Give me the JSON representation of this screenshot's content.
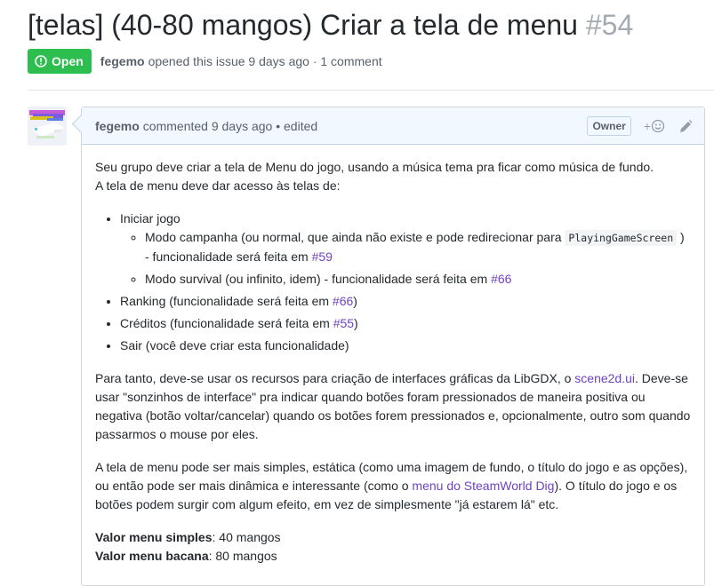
{
  "issue": {
    "title": "[telas] (40-80 mangos) Criar a tela de menu",
    "number": "#54",
    "state": "Open",
    "author": "fegemo",
    "meta": "opened this issue 9 days ago · 1 comment"
  },
  "comment": {
    "author": "fegemo",
    "meta": "commented 9 days ago • edited",
    "owner_label": "Owner",
    "paragraph1_line1": "Seu grupo deve criar a tela de Menu do jogo, usando a música tema pra ficar como música de fundo.",
    "paragraph1_line2": "A tela de menu deve dar acesso às telas de:",
    "list": {
      "item1": "Iniciar jogo",
      "sub1_text": "Modo campanha (ou normal, que ainda não existe e pode redirecionar para ",
      "sub1_code": "PlayingGameScreen",
      "sub1_text2": " ) - funcionalidade será feita em ",
      "sub1_link": "#59",
      "sub2_text": "Modo survival (ou infinito, idem) - funcionalidade será feita em ",
      "sub2_link": "#66",
      "item2_text": "Ranking (funcionalidade será feita em ",
      "item2_link": "#66",
      "item2_end": ")",
      "item3_text": "Créditos (funcionalidade será feita em ",
      "item3_link": "#55",
      "item3_end": ")",
      "item4": "Sair (você deve criar esta funcionalidade)"
    },
    "paragraph2_a": "Para tanto, deve-se usar os recursos para criação de interfaces gráficas da LibGDX, o ",
    "paragraph2_link": "scene2d.ui",
    "paragraph2_b": ". Deve-se usar \"sonzinhos de interface\" pra indicar quando botões foram pressionados de maneira positiva ou negativa (botão voltar/cancelar) quando os botões forem pressionados e, opcionalmente, outro som quando passarmos o mouse por eles.",
    "paragraph3_a": "A tela de menu pode ser mais simples, estática (como uma imagem de fundo, o título do jogo e as opções), ou então pode ser mais dinâmica e interessante (como o ",
    "paragraph3_link": "menu do SteamWorld Dig",
    "paragraph3_b": "). O título do jogo e os botões podem surgir com algum efeito, em vez de simplesmente \"já estarem lá\" etc.",
    "value_simple_label": "Valor menu simples",
    "value_simple": ": 40 mangos",
    "value_fancy_label": "Valor menu bacana",
    "value_fancy": ": 80 mangos"
  },
  "colors": {
    "open_badge": "#2cbe4e",
    "link": "#0366d6",
    "visited_link": "#6f42c1",
    "header_bg": "#f1f8ff"
  },
  "icons": [
    "issue-opened-icon",
    "smiley-icon",
    "pencil-icon"
  ]
}
